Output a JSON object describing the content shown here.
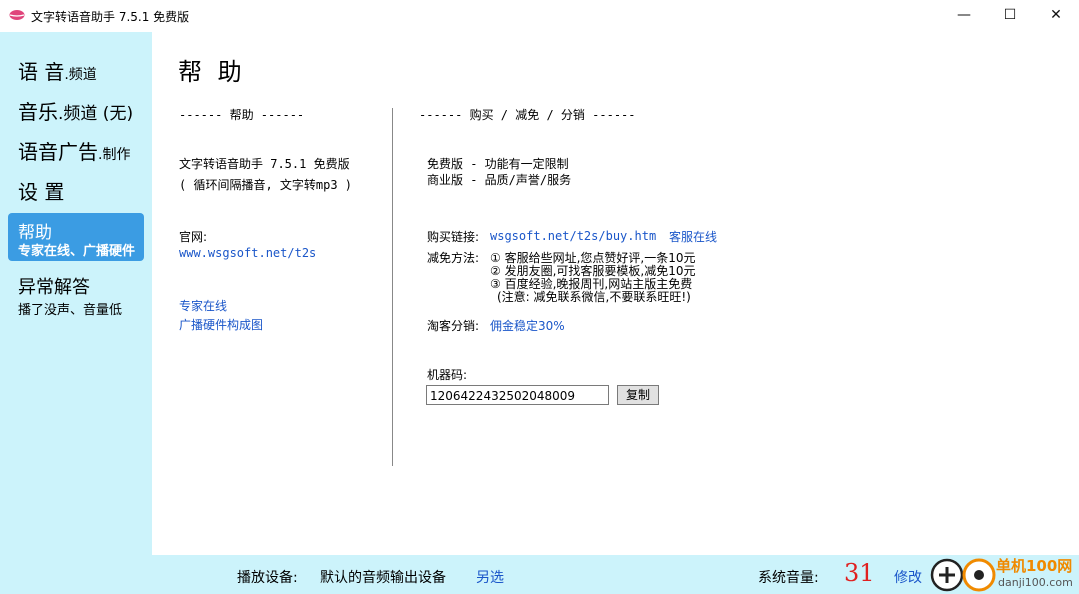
{
  "window": {
    "title": "文字转语音助手 7.5.1 免费版",
    "minimize": "—",
    "maximize": "☐",
    "close": "✕"
  },
  "sidebar": {
    "items": [
      {
        "main": "语 音",
        "sub": ".频道"
      },
      {
        "main": "音乐",
        "sub": ".频道 (无)"
      },
      {
        "main": "语音广告",
        "sub": ".制作"
      },
      {
        "main": "设 置",
        "sub": ""
      },
      {
        "main": "帮助",
        "sub": "专家在线、广播硬件"
      },
      {
        "main": "异常解答",
        "sub": "播了没声、音量低"
      }
    ]
  },
  "content": {
    "title": "帮 助",
    "left_header": "------ 帮助 ------",
    "app_line1": "文字转语音助手 7.5.1 免费版",
    "app_line2": "( 循环间隔播音, 文字转mp3 )",
    "website_label": "官网:",
    "website_url": "www.wsgsoft.net/t2s",
    "expert_link": "专家在线",
    "hardware_link": "广播硬件构成图",
    "right_header": "------ 购买 / 减免 / 分销 ------",
    "free_line": "免费版 - 功能有一定限制",
    "pro_line": "商业版 - 品质/声誉/服务",
    "buy_label": "购买链接:",
    "buy_url": "wsgsoft.net/t2s/buy.htm",
    "service_link": "客服在线",
    "discount_label": "减免方法:",
    "discount_1": "① 客服给些网址,您点赞好评,一条10元",
    "discount_2": "② 发朋友圈,可找客服要模板,减免10元",
    "discount_3": "③ 百度经验,晚报周刊,网站主版主免费",
    "discount_note": "(注意: 减免联系微信,不要联系旺旺!)",
    "distribution_label": "淘客分销:",
    "distribution_link": "佣金稳定30%",
    "machine_label": "机器码:",
    "machine_code": "1206422432502048009",
    "copy_button": "复制"
  },
  "statusbar": {
    "device_label": "播放设备:",
    "device_value": "默认的音频输出设备",
    "device_change": "另选",
    "volume_label": "系统音量:",
    "volume_value": "31",
    "volume_change": "修改",
    "watermark_text": "单机100网",
    "watermark_url": "danji100.com"
  }
}
